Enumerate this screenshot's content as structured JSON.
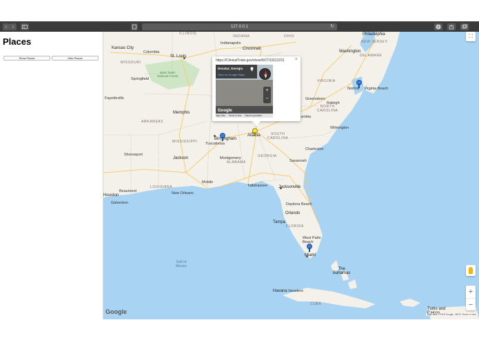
{
  "browser": {
    "url": "127.0.0.1",
    "back_icon": "chevron-left-icon",
    "forward_icon": "chevron-right-icon",
    "sidebar_icon": "sidebar-icon",
    "reader_icon": "reader-icon",
    "reload_icon": "reload-icon",
    "download_icon": "download-icon",
    "share_icon": "share-icon",
    "tabs_icon": "tabs-icon",
    "back_glyph": "‹",
    "forward_glyph": "›",
    "reload_glyph": "↻"
  },
  "sidebar": {
    "title": "Places",
    "show_button": "Show Places",
    "hide_button": "Hide Places"
  },
  "map": {
    "popup": {
      "url": "https://ClinicalTrials.gov/show/NCT03312231",
      "close_glyph": "×",
      "street_place": "Decatur, Georgia",
      "street_link": "View on Google Maps",
      "google_logo": "Google",
      "footer_data": "Map Data",
      "footer_terms": "Terms of Use",
      "footer_report": "Report a problem"
    },
    "labels": {
      "illinois": "ILLINOIS",
      "indiana": "INDIANA",
      "indianapolis": "Indianapolis",
      "kansas_city": "Kansas City",
      "columbia_mo": "Columbia",
      "st_louis": "St. Louis",
      "cincinnati": "Cincinnati",
      "mark_twain": "Mark Twain\nNational Forest",
      "springfield": "Springfield",
      "missouri": "MISSOURI",
      "fayetteville": "Fayetteville",
      "arkansas": "ARKANSAS",
      "memphis": "Memphis",
      "mississippi": "MISSISSIPPI",
      "birmingham": "Birmingham",
      "tuscaloosa": "Tuscaloosa",
      "atlanta": "Atlanta",
      "georgia": "GEORGIA",
      "montgomery": "Montgomery",
      "alabama": "ALABAMA",
      "shreveport": "Shreveport",
      "jackson": "Jackson",
      "louisiana": "LOUISIANA",
      "beaumont": "Beaumont",
      "houston": "Houston",
      "galveston": "Galveston",
      "new_orleans": "New Orleans",
      "mobile": "Mobile",
      "tallahassee": "Tallahassee",
      "jacksonville": "Jacksonville",
      "daytona": "Daytona Beach",
      "orlando": "Orlando",
      "tampa": "Tampa",
      "florida": "FLORIDA",
      "west_palm": "West Palm\nBeach",
      "miami": "Miami",
      "gulf_of_mexico": "Gulf of\nMexico",
      "the_bahamas": "The\nBahamas",
      "havana": "Havana",
      "varadero": "Varadero",
      "cuba": "CUBA",
      "turks_caicos": "Turks and\nCaicos",
      "philadelphia": "Philadelphia",
      "washington": "Washington",
      "new_jersey": "NEW JERSEY",
      "delaware": "DELAWARE",
      "virginia": "VIRGINIA",
      "norfolk": "Norfolk",
      "virginia_beach": "Virginia Beach",
      "greensboro": "Greensboro",
      "raleigh": "Raleigh",
      "north_carolina": "NORTH\nCAROLINA",
      "wilmington": "Wilmington",
      "south_carolina": "SOUTH\nCAROLINA",
      "charleston": "Charleston",
      "savannah": "Savannah",
      "columbia_sc": "Columbia",
      "ohio": "OHIO"
    },
    "markers": [
      {
        "name": "marker-decatur",
        "color": "#f5e13b",
        "selected": true
      },
      {
        "name": "marker-birmingham",
        "color": "#3d7dd8",
        "selected": false
      },
      {
        "name": "marker-norfolk",
        "color": "#3d7dd8",
        "selected": false
      },
      {
        "name": "marker-miami",
        "color": "#3d7dd8",
        "selected": false
      }
    ],
    "google_logo": "Google",
    "attribution": "Map data ©2018 Google, INEGI   Terms of Use",
    "fullscreen_icon": "fullscreen-icon",
    "pegman_icon": "pegman-icon",
    "zoom_in_glyph": "+",
    "zoom_out_glyph": "−",
    "fullscreen_glyph": "⛶",
    "colors": {
      "water": "#a9d3f2",
      "land": "#f4f1ea",
      "forest": "#cfe6c6",
      "highway": "#f7cb6a",
      "marker_selected": "#f5e13b",
      "marker_default": "#3d7dd8"
    }
  }
}
